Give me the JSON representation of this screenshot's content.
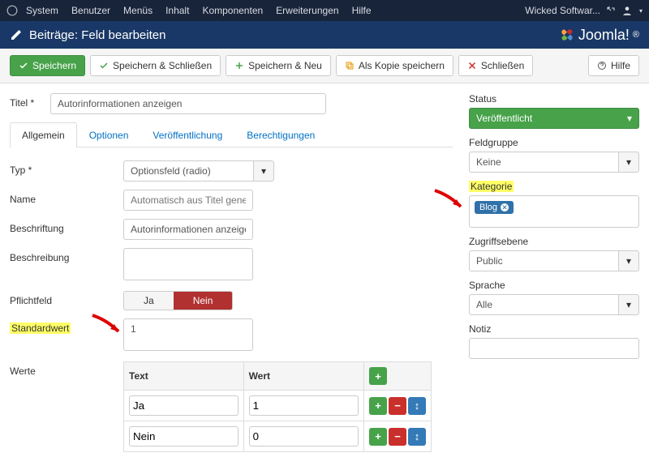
{
  "topbar": {
    "items": [
      "System",
      "Benutzer",
      "Menüs",
      "Inhalt",
      "Komponenten",
      "Erweiterungen",
      "Hilfe"
    ],
    "site": "Wicked Softwar..."
  },
  "header": {
    "title": "Beiträge: Feld bearbeiten",
    "brand": "Joomla!"
  },
  "toolbar": {
    "save": "Speichern",
    "saveclose": "Speichern & Schließen",
    "savenew": "Speichern & Neu",
    "savecopy": "Als Kopie speichern",
    "close": "Schließen",
    "help": "Hilfe"
  },
  "title": {
    "label": "Titel *",
    "value": "Autorinformationen anzeigen"
  },
  "tabs": [
    "Allgemein",
    "Optionen",
    "Veröffentlichung",
    "Berechtigungen"
  ],
  "form": {
    "type": {
      "label": "Typ *",
      "value": "Optionsfeld (radio)"
    },
    "name": {
      "label": "Name",
      "placeholder": "Automatisch aus Titel generieren"
    },
    "caption": {
      "label": "Beschriftung",
      "value": "Autorinformationen anzeigen"
    },
    "desc": {
      "label": "Beschreibung"
    },
    "required": {
      "label": "Pflichtfeld",
      "yes": "Ja",
      "no": "Nein"
    },
    "default": {
      "label": "Standardwert",
      "value": "1"
    },
    "values": {
      "label": "Werte",
      "col_text": "Text",
      "col_value": "Wert",
      "rows": [
        {
          "text": "Ja",
          "value": "1"
        },
        {
          "text": "Nein",
          "value": "0"
        }
      ]
    }
  },
  "side": {
    "status": {
      "label": "Status",
      "value": "Veröffentlicht"
    },
    "group": {
      "label": "Feldgruppe",
      "value": "Keine"
    },
    "category": {
      "label": "Kategorie",
      "tag": "Blog"
    },
    "access": {
      "label": "Zugriffsebene",
      "value": "Public"
    },
    "language": {
      "label": "Sprache",
      "value": "Alle"
    },
    "note": {
      "label": "Notiz"
    }
  }
}
